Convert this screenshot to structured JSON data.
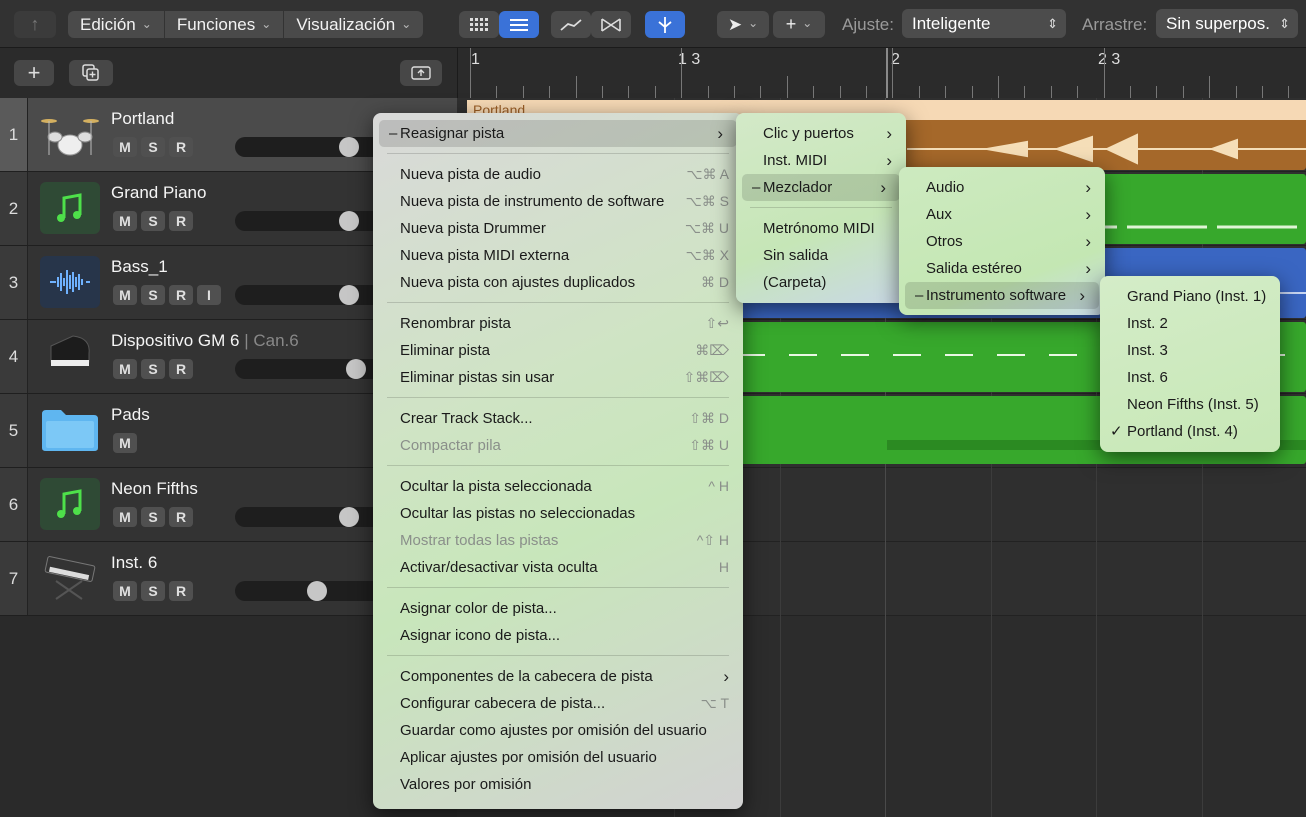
{
  "toolbar": {
    "edit": "Edición",
    "functions": "Funciones",
    "view": "Visualización",
    "snap_label": "Ajuste:",
    "snap_value": "Inteligente",
    "drag_label": "Arrastre:",
    "drag_value": "Sin superpos."
  },
  "ruler": {
    "bars": [
      "1",
      "1 3",
      "2",
      "2 3"
    ]
  },
  "tracks": [
    {
      "num": "1",
      "name": "Portland",
      "sub": "",
      "buttons": [
        "M",
        "S",
        "R"
      ]
    },
    {
      "num": "2",
      "name": "Grand Piano",
      "sub": "",
      "buttons": [
        "M",
        "S",
        "R"
      ]
    },
    {
      "num": "3",
      "name": "Bass_1",
      "sub": "",
      "buttons": [
        "M",
        "S",
        "R",
        "I"
      ]
    },
    {
      "num": "4",
      "name": "Dispositivo GM 6",
      "sub": " | Can.6",
      "buttons": [
        "M",
        "S",
        "R"
      ]
    },
    {
      "num": "5",
      "name": "Pads",
      "sub": "",
      "buttons": [
        "M"
      ]
    },
    {
      "num": "6",
      "name": "Neon Fifths",
      "sub": "",
      "buttons": [
        "M",
        "S",
        "R"
      ]
    },
    {
      "num": "7",
      "name": "Inst. 6",
      "sub": "",
      "buttons": [
        "M",
        "S",
        "R"
      ]
    }
  ],
  "volume_levels": [
    0.8,
    0.8,
    0.8,
    0.85,
    null,
    0.8,
    0.55
  ],
  "regions": {
    "portland_title": "Portland"
  },
  "context_menu": {
    "items": [
      {
        "label": "Reasignar pista",
        "shortcut": "",
        "submenu": true,
        "highlight": true
      },
      {
        "sep": true
      },
      {
        "label": "Nueva pista de audio",
        "shortcut": "⌥⌘ A"
      },
      {
        "label": "Nueva pista de instrumento de software",
        "shortcut": "⌥⌘ S"
      },
      {
        "label": "Nueva pista Drummer",
        "shortcut": "⌥⌘ U"
      },
      {
        "label": "Nueva pista MIDI externa",
        "shortcut": "⌥⌘ X"
      },
      {
        "label": "Nueva pista con ajustes duplicados",
        "shortcut": "⌘ D"
      },
      {
        "sep": true
      },
      {
        "label": "Renombrar pista",
        "shortcut": "⇧↩"
      },
      {
        "label": "Eliminar pista",
        "shortcut": "⌘⌦"
      },
      {
        "label": "Eliminar pistas sin usar",
        "shortcut": "⇧⌘⌦"
      },
      {
        "sep": true
      },
      {
        "label": "Crear Track Stack...",
        "shortcut": "⇧⌘ D"
      },
      {
        "label": "Compactar pila",
        "shortcut": "⇧⌘ U",
        "disabled": true
      },
      {
        "sep": true
      },
      {
        "label": "Ocultar la pista seleccionada",
        "shortcut": "^ H"
      },
      {
        "label": "Ocultar las pistas no seleccionadas",
        "shortcut": ""
      },
      {
        "label": "Mostrar todas las pistas",
        "shortcut": "^⇧ H",
        "disabled": true
      },
      {
        "label": "Activar/desactivar vista oculta",
        "shortcut": "H"
      },
      {
        "sep": true
      },
      {
        "label": "Asignar color de pista...",
        "shortcut": ""
      },
      {
        "label": "Asignar icono de pista...",
        "shortcut": ""
      },
      {
        "sep": true
      },
      {
        "label": "Componentes de la cabecera de pista",
        "shortcut": "",
        "submenu": true
      },
      {
        "label": "Configurar cabecera de pista...",
        "shortcut": "⌥ T"
      },
      {
        "label": "Guardar como ajustes por omisión del usuario",
        "shortcut": ""
      },
      {
        "label": "Aplicar ajustes por omisión del usuario",
        "shortcut": ""
      },
      {
        "label": "Valores por omisión",
        "shortcut": ""
      }
    ]
  },
  "submenu1": {
    "items": [
      {
        "label": "Clic y puertos",
        "submenu": true
      },
      {
        "label": "Inst. MIDI",
        "submenu": true
      },
      {
        "label": "Mezclador",
        "submenu": true,
        "highlight": true
      },
      {
        "sep": true
      },
      {
        "label": "Metrónomo MIDI"
      },
      {
        "label": "Sin salida"
      },
      {
        "label": "(Carpeta)"
      }
    ]
  },
  "submenu2": {
    "items": [
      {
        "label": "Audio",
        "submenu": true
      },
      {
        "label": "Aux",
        "submenu": true
      },
      {
        "label": "Otros",
        "submenu": true
      },
      {
        "label": "Salida estéreo",
        "submenu": true
      },
      {
        "label": "Instrumento software",
        "submenu": true,
        "highlight": true
      }
    ]
  },
  "submenu3": {
    "items": [
      {
        "label": "Grand Piano (Inst. 1)"
      },
      {
        "label": "Inst. 2"
      },
      {
        "label": "Inst. 3"
      },
      {
        "label": "Inst. 6"
      },
      {
        "label": "Neon Fifths (Inst. 5)"
      },
      {
        "label": "Portland (Inst. 4)",
        "checked": true
      }
    ]
  },
  "colors": {
    "menu_bg": "#cfe0c6",
    "region_orange": "#a5682a",
    "region_green": "#37a82c",
    "region_blue": "#3a66c2",
    "accent_blue": "#3a72d8"
  }
}
